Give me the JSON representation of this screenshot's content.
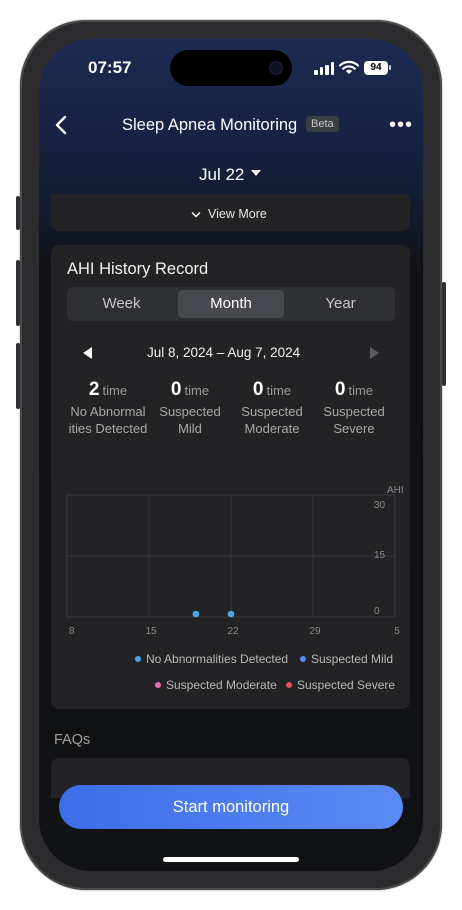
{
  "status_bar": {
    "time": "07:57",
    "battery": "94"
  },
  "header": {
    "title": "Sleep Apnea Monitoring",
    "badge": "Beta",
    "more": "•••"
  },
  "date_selector": {
    "label": "Jul 22"
  },
  "view_more": {
    "label": "View More"
  },
  "ahi_card": {
    "title": "AHI History Record",
    "tabs": [
      {
        "label": "Week",
        "active": false
      },
      {
        "label": "Month",
        "active": true
      },
      {
        "label": "Year",
        "active": false
      }
    ],
    "range": "Jul 8, 2024 – Aug 7, 2024",
    "stats": [
      {
        "count": "2",
        "unit": "time",
        "label": "No Abnormal ities Detected"
      },
      {
        "count": "0",
        "unit": "time",
        "label": "Suspected Mild"
      },
      {
        "count": "0",
        "unit": "time",
        "label": "Suspected Moderate"
      },
      {
        "count": "0",
        "unit": "time",
        "label": "Suspected Severe"
      }
    ]
  },
  "chart_data": {
    "type": "scatter",
    "ylabel": "AHI",
    "ylim": [
      0,
      30
    ],
    "yticks": [
      "30",
      "15",
      "0"
    ],
    "xticks": [
      "8",
      "15",
      "22",
      "29",
      "5"
    ],
    "xlim": [
      8,
      36
    ],
    "grid": true,
    "points": [
      {
        "x": 19,
        "y": 0,
        "category": "No Abnormalities Detected"
      },
      {
        "x": 22,
        "y": 0,
        "category": "No Abnormalities Detected"
      }
    ],
    "legend": [
      {
        "name": "No Abnormalities Detected",
        "color": "#49a7e8"
      },
      {
        "name": "Suspected Mild",
        "color": "#5b8af5"
      },
      {
        "name": "Suspected Moderate",
        "color": "#e36fb0"
      },
      {
        "name": "Suspected Severe",
        "color": "#e84f5b"
      }
    ],
    "legend_position": "bottom"
  },
  "faq": {
    "title": "FAQs"
  },
  "cta": {
    "label": "Start monitoring"
  }
}
